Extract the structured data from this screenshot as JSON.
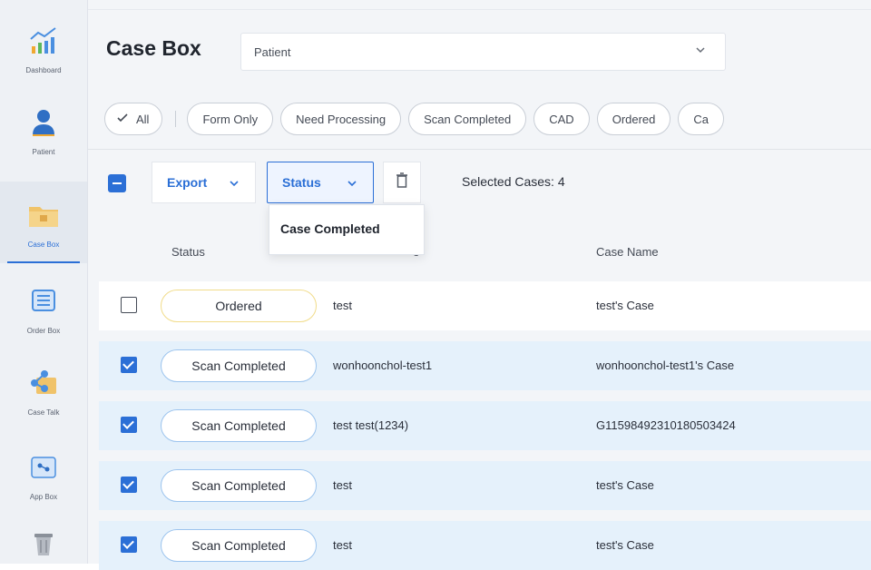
{
  "sidebar": {
    "items": [
      {
        "label": "Dashboard",
        "icon": "chart-icon"
      },
      {
        "label": "Patient",
        "icon": "person-icon"
      },
      {
        "label": "Case Box",
        "icon": "folder-icon",
        "active": true
      },
      {
        "label": "Order Box",
        "icon": "list-icon"
      },
      {
        "label": "Case Talk",
        "icon": "share-icon"
      },
      {
        "label": "App Box",
        "icon": "app-icon"
      },
      {
        "label": "",
        "icon": "trash-icon"
      }
    ]
  },
  "header": {
    "title": "Case Box",
    "search_type": "Patient"
  },
  "filters": [
    "Form Only",
    "Need Processing",
    "Scan Completed",
    "CAD",
    "Ordered",
    "Ca"
  ],
  "filter_all": "All",
  "toolbar": {
    "export_label": "Export",
    "status_label": "Status",
    "selected_text": "Selected Cases: 4"
  },
  "status_menu": {
    "items": [
      "Case Completed"
    ]
  },
  "table": {
    "headers": [
      "Status",
      "e",
      "Case Name"
    ],
    "rows": [
      {
        "selected": false,
        "status": "Ordered",
        "patient": "test",
        "case_name": "test's Case"
      },
      {
        "selected": true,
        "status": "Scan Completed",
        "patient": "wonhoonchol-test1",
        "case_name": "wonhoonchol-test1's Case"
      },
      {
        "selected": true,
        "status": "Scan Completed",
        "patient": "test test(1234)",
        "case_name": "G1159849231018050342‌4"
      },
      {
        "selected": true,
        "status": "Scan Completed",
        "patient": "test",
        "case_name": "test's Case"
      },
      {
        "selected": true,
        "status": "Scan Completed",
        "patient": "test",
        "case_name": "test's Case"
      }
    ]
  },
  "colors": {
    "accent": "#2b6fd6",
    "selected_row": "#e5f1fb",
    "ordered_border": "#f1dc8a",
    "scan_border": "#9cc4ee"
  }
}
